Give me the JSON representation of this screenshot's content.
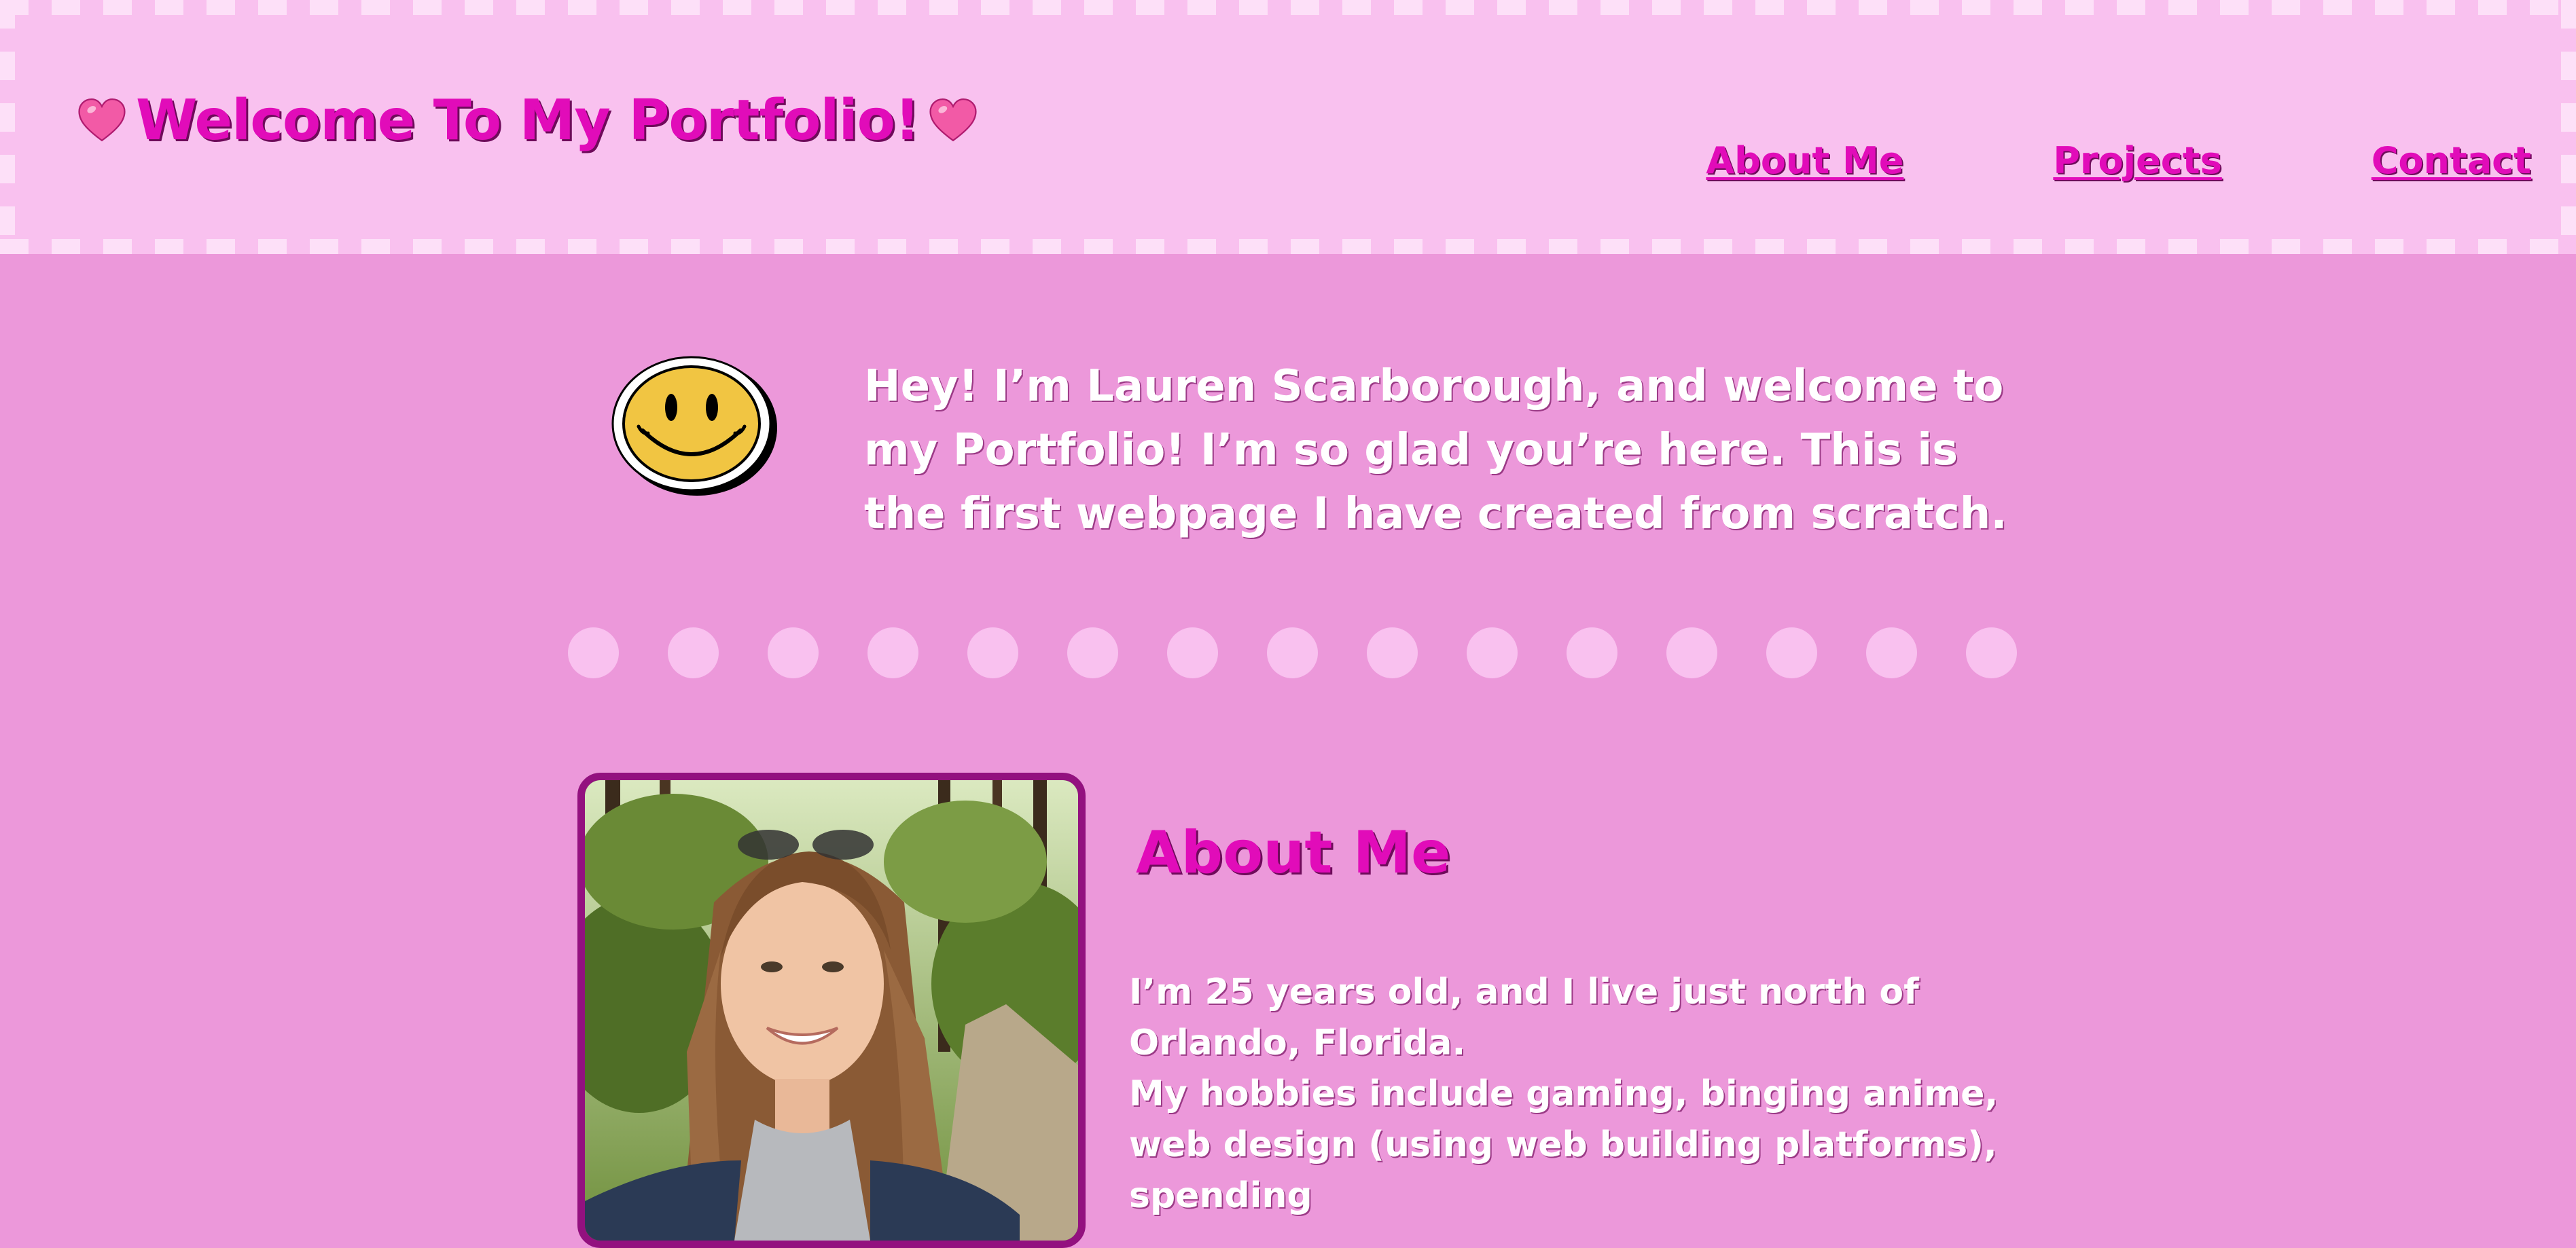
{
  "header": {
    "title": "Welcome To My Portfolio!",
    "left_icon": "heart-icon",
    "right_icon": "heart-icon"
  },
  "nav": {
    "items": [
      {
        "label": "About Me"
      },
      {
        "label": "Projects"
      },
      {
        "label": "Contact"
      }
    ]
  },
  "intro": {
    "icon": "smiley-face-icon",
    "text": "Hey! I’m Lauren Scarborough, and welcome to my Portfolio! I’m so glad you’re here. This is the first webpage I have created from scratch."
  },
  "divider": {
    "dot_count": 15
  },
  "about": {
    "heading": "About Me",
    "paragraph_1": "I’m 25 years old, and I live just north of Orlando, Florida.",
    "paragraph_2": "My hobbies include gaming, binging anime, web design (using web building platforms), spending"
  },
  "colors": {
    "page_background": "#ec98da",
    "header_background": "#f9c1ef",
    "accent_pink": "#e10cb9",
    "photo_border": "#93117f",
    "dot": "#f9c1ef"
  }
}
